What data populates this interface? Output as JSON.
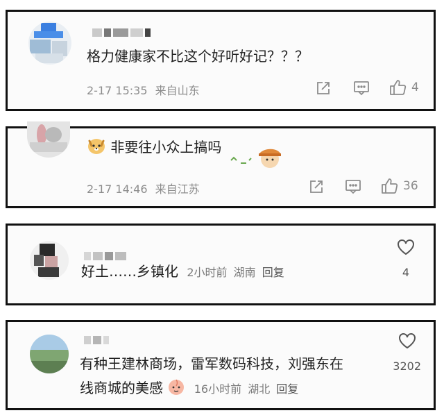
{
  "comments": [
    {
      "text": "格力健康家不比这个好听好记？？？",
      "date": "2-17 15:35",
      "location": "来自山东",
      "share_icon": "share-icon",
      "comment_icon": "comment-icon",
      "like_icon": "thumbs-up-icon",
      "like_count": "4"
    },
    {
      "text": "非要往小众上搞吗",
      "date": "2-17 14:46",
      "location": "来自江苏",
      "share_icon": "share-icon",
      "comment_icon": "comment-icon",
      "like_icon": "thumbs-up-icon",
      "like_count": "36"
    },
    {
      "text": "好土……乡镇化",
      "time": "2小时前",
      "location": "湖南",
      "reply": "回复",
      "like_icon": "heart-icon",
      "like_count": "4"
    },
    {
      "text_line1": "有种王建林商场，雷军数码科技，刘强东在",
      "text_line2": "线商城的美感",
      "time": "16小时前",
      "location": "湖北",
      "reply": "回复",
      "like_icon": "heart-icon",
      "like_count": "3202"
    }
  ],
  "colors": {
    "border": "#111111",
    "meta": "#8c8c8c",
    "text": "#1f1f1f"
  }
}
